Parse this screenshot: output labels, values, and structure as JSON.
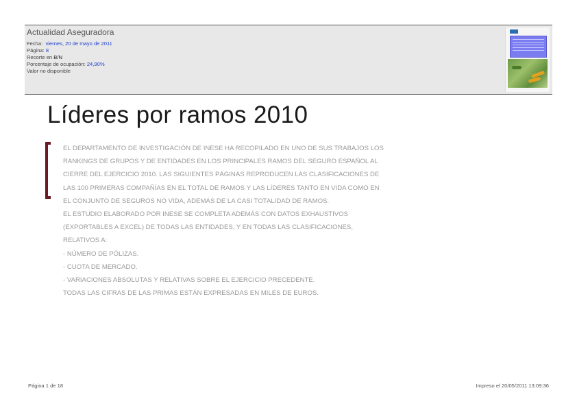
{
  "header": {
    "publication": "Actualidad Aseguradora",
    "fecha_label": "Fecha:",
    "fecha_value": "viernes, 20 de mayo de 2011",
    "pagina_label": "Página:",
    "pagina_value": "8",
    "recorte_label": "Recorte en",
    "recorte_value": "B/N",
    "ocupacion_label": "Porcentaje de ocupación:",
    "ocupacion_value": "24,90%",
    "valor": "Valor no disponible"
  },
  "article": {
    "title": "Líderes por ramos 2010",
    "lines": [
      "EL DEPARTAMENTO DE INVESTIGACIÓN DE INESE HA RECOPILADO EN UNO DE SUS TRABAJOS LOS",
      "RANKINGS DE GRUPOS Y DE ENTIDADES EN LOS PRINCIPALES RAMOS DEL SEGURO ESPAÑOL AL",
      "CIERRE DEL EJERCICIO 2010. LAS SIGUIENTES PÁGINAS REPRODUCEN LAS CLASIFICACIONES DE",
      "LAS 100 PRIMERAS COMPAÑÍAS EN EL TOTAL DE RAMOS Y LAS LÍDERES TANTO EN VIDA COMO EN",
      "EL CONJUNTO DE SEGUROS NO VIDA, ADEMÁS DE LA CASI TOTALIDAD DE RAMOS.",
      "EL ESTUDIO ELABORADO POR INESE SE COMPLETA ADEMÁS CON DATOS EXHAUSTIVOS",
      "(EXPORTABLES A EXCEL) DE TODAS LAS ENTIDADES, Y EN TODAS LAS CLASIFICACIONES,",
      "RELATIVOS A:",
      "- NÚMERO DE PÓLIZAS.",
      "- CUOTA DE MERCADO.",
      "- VARIACIONES ABSOLUTAS Y RELATIVAS SOBRE EL EJERCICIO PRECEDENTE.",
      "TODAS LAS CIFRAS DE LAS PRIMAS ESTÁN EXPRESADAS EN MILES DE EUROS."
    ]
  },
  "footer": {
    "page": "Página 1 de 18",
    "printed": "Impreso el 20/05/2011 13:09:36"
  },
  "colors": {
    "accent_bracket": "#6b1a22",
    "meta_value": "#1f3fd0"
  }
}
